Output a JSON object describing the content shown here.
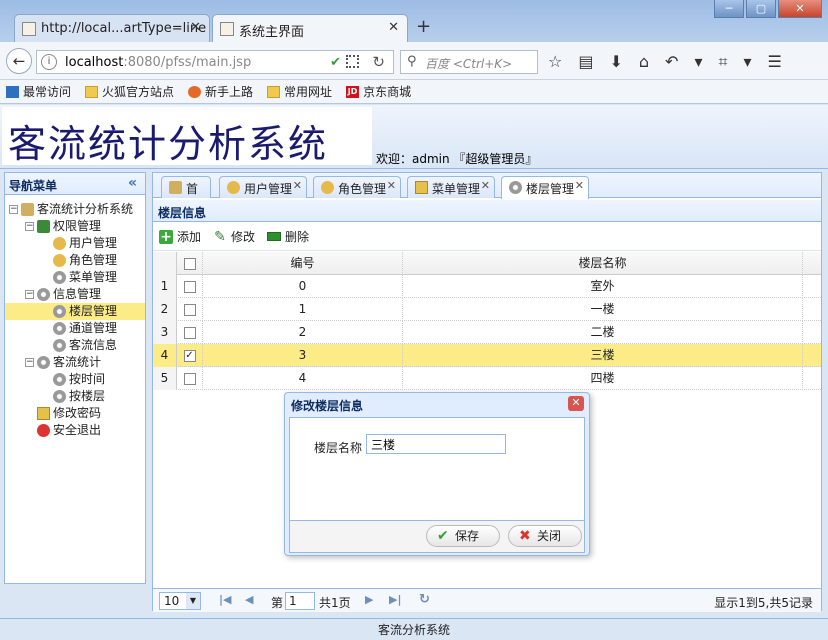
{
  "browser": {
    "tabs": [
      {
        "title": "http://local...artType=line"
      },
      {
        "title": "系统主界面"
      }
    ],
    "url_host": "localhost",
    "url_rest": ":8080/pfss/main.jsp",
    "search_placeholder": "百度 <Ctrl+K>",
    "bookmarks": [
      "最常访问",
      "火狐官方站点",
      "新手上路",
      "常用网址",
      "京东商城"
    ]
  },
  "header": {
    "app_title": "客流统计分析系统",
    "welcome": "欢迎：admin 『超级管理员』"
  },
  "sidebar": {
    "title": "导航菜单",
    "collapse_glyph": "«",
    "root": "客流统计分析系统",
    "groups": [
      {
        "label": "权限管理",
        "items": [
          "用户管理",
          "角色管理",
          "菜单管理"
        ]
      },
      {
        "label": "信息管理",
        "items": [
          "楼层管理",
          "通道管理",
          "客流信息"
        ]
      },
      {
        "label": "客流统计",
        "items": [
          "按时间",
          "按楼层"
        ]
      }
    ],
    "extra": [
      "修改密码",
      "安全退出"
    ],
    "selected": "楼层管理"
  },
  "main_tabs": [
    {
      "label": "首页",
      "closable": false
    },
    {
      "label": "用户管理",
      "closable": true
    },
    {
      "label": "角色管理",
      "closable": true
    },
    {
      "label": "菜单管理",
      "closable": true
    },
    {
      "label": "楼层管理",
      "closable": true
    }
  ],
  "panel": {
    "title": "楼层信息",
    "toolbar": {
      "add": "添加",
      "edit": "修改",
      "delete": "删除"
    },
    "columns": {
      "id": "编号",
      "name": "楼层名称"
    },
    "rows": [
      {
        "rn": "1",
        "id": "0",
        "name": "室外",
        "checked": false
      },
      {
        "rn": "2",
        "id": "1",
        "name": "一楼",
        "checked": false
      },
      {
        "rn": "3",
        "id": "2",
        "name": "二楼",
        "checked": false
      },
      {
        "rn": "4",
        "id": "3",
        "name": "三楼",
        "checked": true
      },
      {
        "rn": "5",
        "id": "4",
        "name": "四楼",
        "checked": false
      }
    ]
  },
  "pager": {
    "page_size": "10",
    "page_prefix": "第",
    "page_num": "1",
    "page_total": "共1页",
    "info": "显示1到5,共5记录"
  },
  "dialog": {
    "title": "修改楼层信息",
    "field_label": "楼层名称",
    "field_value": "三楼",
    "save": "保存",
    "close": "关闭"
  },
  "footer": "客流分析系统",
  "colors": {
    "selected_row": "#fbec88",
    "panel_border": "#95b8e7"
  }
}
